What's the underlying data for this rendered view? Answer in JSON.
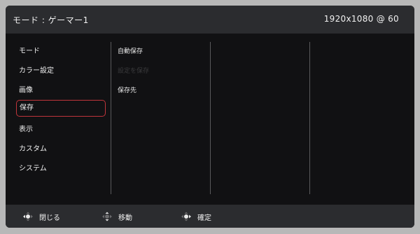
{
  "header": {
    "mode_label": "モード : ゲーマー1",
    "resolution": "1920x1080 @ 60"
  },
  "menu": {
    "items": [
      {
        "label": "モード"
      },
      {
        "label": "カラー設定"
      },
      {
        "label": "画像"
      },
      {
        "label": "保存"
      },
      {
        "label": "表示"
      },
      {
        "label": "カスタム"
      },
      {
        "label": "システム"
      }
    ],
    "selected_index": 3
  },
  "submenu": {
    "items": [
      {
        "label": "自動保存"
      },
      {
        "label": "設定を保存"
      },
      {
        "label": "保存先"
      }
    ]
  },
  "footer": {
    "close_label": "閉じる",
    "move_label": "移動",
    "confirm_label": "確定"
  },
  "colors": {
    "highlight": "#c1353b",
    "panel_bg": "#111113",
    "bar_bg": "#2b2c2f"
  }
}
